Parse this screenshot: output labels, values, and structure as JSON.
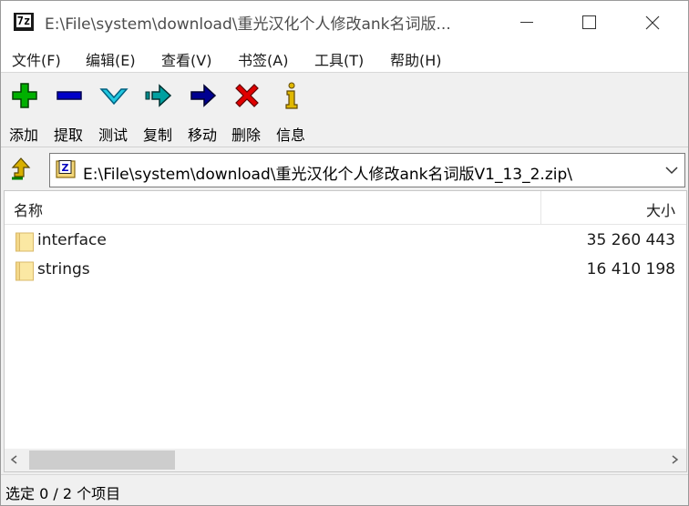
{
  "window": {
    "title": "E:\\File\\system\\download\\重光汉化个人修改ank名词版...",
    "app_icon_text": "7z"
  },
  "menu": [
    "文件(F)",
    "编辑(E)",
    "查看(V)",
    "书签(A)",
    "工具(T)",
    "帮助(H)"
  ],
  "toolbar": [
    {
      "label": "添加",
      "icon": "add-icon",
      "color": "#00a800"
    },
    {
      "label": "提取",
      "icon": "extract-icon",
      "color": "#0000c0"
    },
    {
      "label": "测试",
      "icon": "test-icon",
      "color": "#1ec0d8"
    },
    {
      "label": "复制",
      "icon": "copy-icon",
      "color": "#008080"
    },
    {
      "label": "移动",
      "icon": "move-icon",
      "color": "#000080"
    },
    {
      "label": "删除",
      "icon": "delete-icon",
      "color": "#e00000"
    },
    {
      "label": "信息",
      "icon": "info-icon",
      "color": "#c8a000"
    }
  ],
  "address": {
    "path": "E:\\File\\system\\download\\重光汉化个人修改ank名词版V1_13_2.zip\\"
  },
  "list": {
    "columns": {
      "name": "名称",
      "size": "大小"
    },
    "rows": [
      {
        "name": "interface",
        "size": "35 260 443",
        "type": "folder"
      },
      {
        "name": "strings",
        "size": "16 410 198",
        "type": "folder"
      }
    ],
    "scroll_position": 0
  },
  "status": {
    "text": "选定 0 / 2 个项目"
  }
}
